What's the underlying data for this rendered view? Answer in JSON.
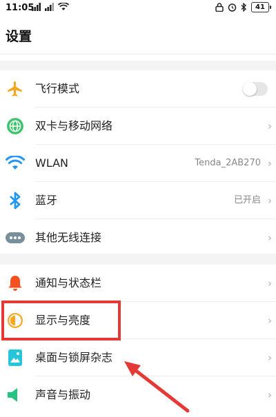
{
  "status_bar": {
    "time": "11:05",
    "battery": "41",
    "icons_left": [
      "signal-icon",
      "signal-icon",
      "wifi-icon"
    ],
    "icons_right": [
      "lock-icon",
      "alarm-icon",
      "bluetooth-icon",
      "battery-icon"
    ]
  },
  "page": {
    "title": "设置"
  },
  "sections": [
    {
      "items": [
        {
          "label": "飞行模式",
          "icon": "airplane-icon",
          "control": "toggle",
          "toggle_on": false,
          "color": "#f6a623"
        },
        {
          "label": "双卡与移动网络",
          "icon": "globe-icon",
          "control": "chevron",
          "color": "#3ec46d"
        },
        {
          "label": "WLAN",
          "icon": "wifi-icon",
          "value": "Tenda_2AB270",
          "control": "chevron",
          "color": "#2196f3"
        },
        {
          "label": "蓝牙",
          "icon": "bluetooth-icon",
          "value": "已开启",
          "control": "chevron",
          "color": "#2196f3"
        },
        {
          "label": "其他无线连接",
          "icon": "more-dots-icon",
          "control": "chevron",
          "color": "#78909c"
        }
      ]
    },
    {
      "items": [
        {
          "label": "通知与状态栏",
          "icon": "bell-icon",
          "control": "chevron",
          "color": "#f4511e"
        },
        {
          "label": "显示与亮度",
          "icon": "brightness-icon",
          "control": "chevron",
          "color": "#f9a825"
        },
        {
          "label": "桌面与锁屏杂志",
          "icon": "wallpaper-icon",
          "control": "chevron",
          "color": "#26c6da"
        },
        {
          "label": "声音与振动",
          "icon": "speaker-icon",
          "control": "chevron",
          "color": "#26c281"
        }
      ]
    }
  ],
  "chevron": "›",
  "annotation": {
    "highlight_color": "#e53935",
    "highlight_target": "显示与亮度"
  }
}
